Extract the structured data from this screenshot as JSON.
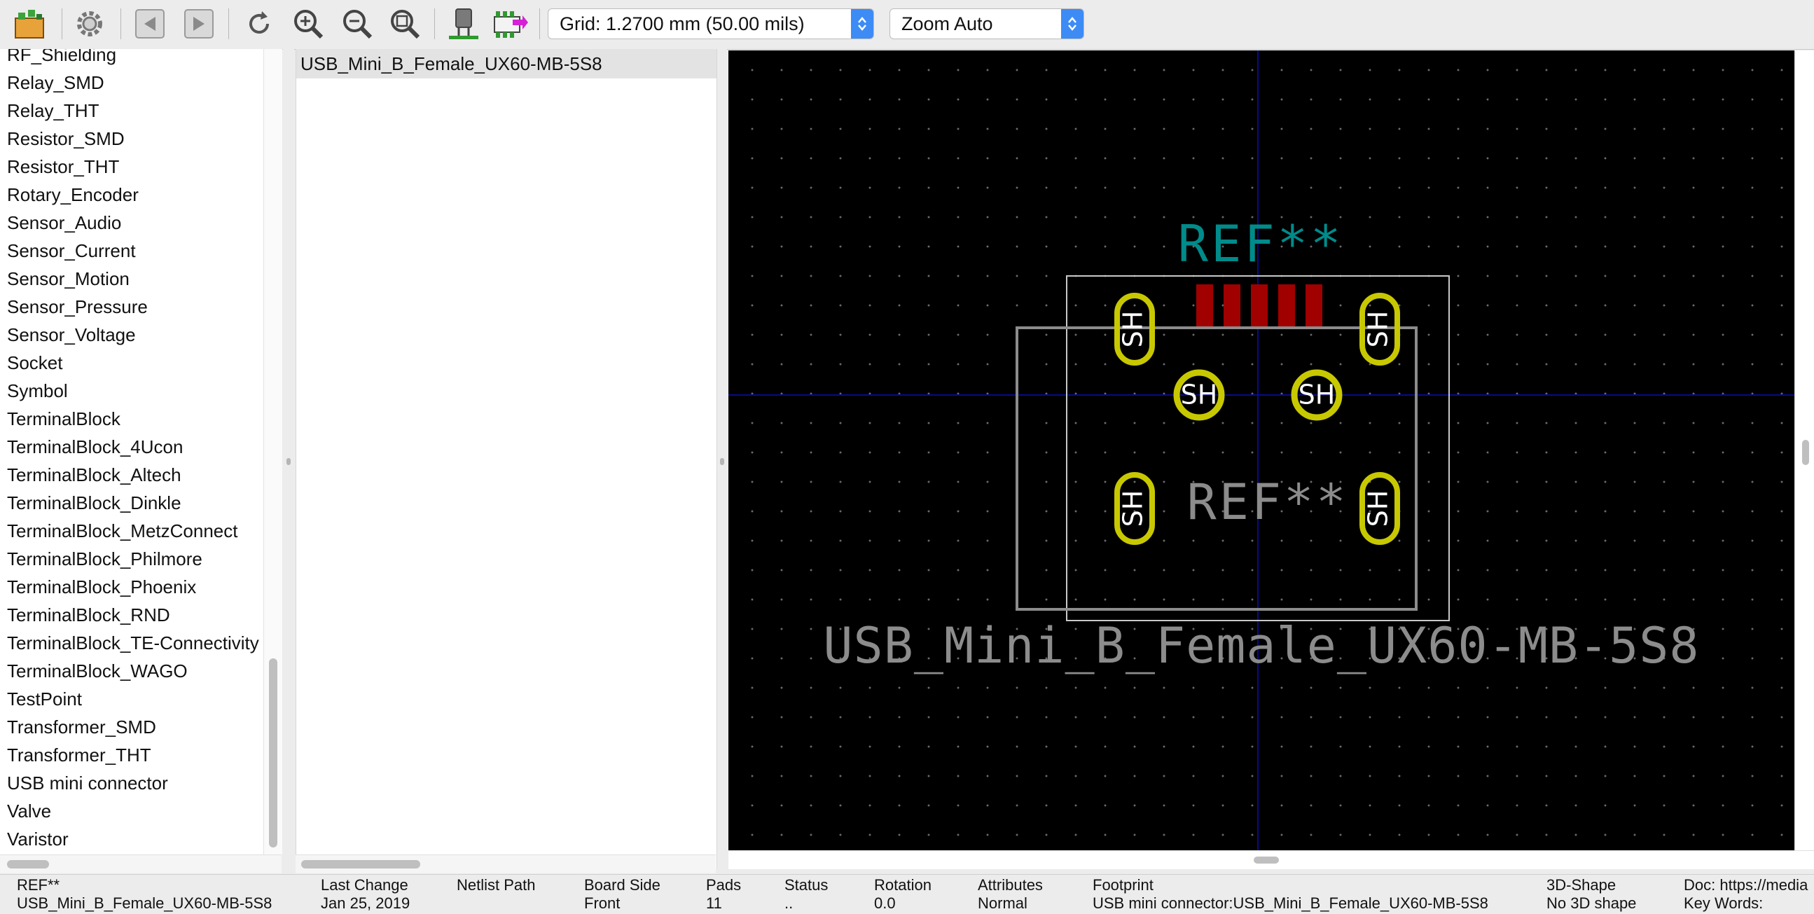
{
  "toolbar": {
    "icons": [
      "load-library-icon",
      "settings-icon",
      "back-arrow-icon",
      "forward-arrow-icon",
      "refresh-icon",
      "zoom-in-icon",
      "zoom-out-icon",
      "zoom-fit-icon",
      "3d-viewer-icon",
      "insert-footprint-icon"
    ],
    "grid_value": "Grid: 1.2700 mm (50.00 mils)",
    "zoom_value": "Zoom Auto"
  },
  "libraries": {
    "items": [
      "RF_Shielding",
      "Relay_SMD",
      "Relay_THT",
      "Resistor_SMD",
      "Resistor_THT",
      "Rotary_Encoder",
      "Sensor_Audio",
      "Sensor_Current",
      "Sensor_Motion",
      "Sensor_Pressure",
      "Sensor_Voltage",
      "Socket",
      "Symbol",
      "TerminalBlock",
      "TerminalBlock_4Ucon",
      "TerminalBlock_Altech",
      "TerminalBlock_Dinkle",
      "TerminalBlock_MetzConnect",
      "TerminalBlock_Philmore",
      "TerminalBlock_Phoenix",
      "TerminalBlock_RND",
      "TerminalBlock_TE-Connectivity",
      "TerminalBlock_WAGO",
      "TestPoint",
      "Transformer_SMD",
      "Transformer_THT",
      "USB mini connector",
      "Valve",
      "Varistor"
    ]
  },
  "footprints": {
    "items": [
      "USB_Mini_B_Female_UX60-MB-5S8"
    ]
  },
  "canvas": {
    "ref_top": "REF**",
    "ref_fab": "REF**",
    "footprint_name": "USB_Mini_B_Female_UX60-MB-5S8",
    "pad_label": "SH",
    "colors": {
      "background": "#000000",
      "pad": "#c8c800",
      "smd_pad": "#a00000",
      "silk": "#008b8b",
      "fab": "#8c8c8c",
      "axis": "#00008b"
    }
  },
  "status": {
    "columns": [
      {
        "label": "REF**",
        "value": "USB_Mini_B_Female_UX60-MB-5S8"
      },
      {
        "label": "Last Change",
        "value": "Jan 25, 2019"
      },
      {
        "label": "Netlist Path",
        "value": ""
      },
      {
        "label": "Board Side",
        "value": "Front"
      },
      {
        "label": "Pads",
        "value": "11"
      },
      {
        "label": "Status",
        "value": ".."
      },
      {
        "label": "Rotation",
        "value": "0.0"
      },
      {
        "label": "Attributes",
        "value": "Normal"
      },
      {
        "label": "Footprint",
        "value": "USB mini connector:USB_Mini_B_Female_UX60-MB-5S8"
      },
      {
        "label": "3D-Shape",
        "value": "No 3D shape"
      },
      {
        "label": "Doc: https://media",
        "value": "Key Words:"
      }
    ]
  }
}
